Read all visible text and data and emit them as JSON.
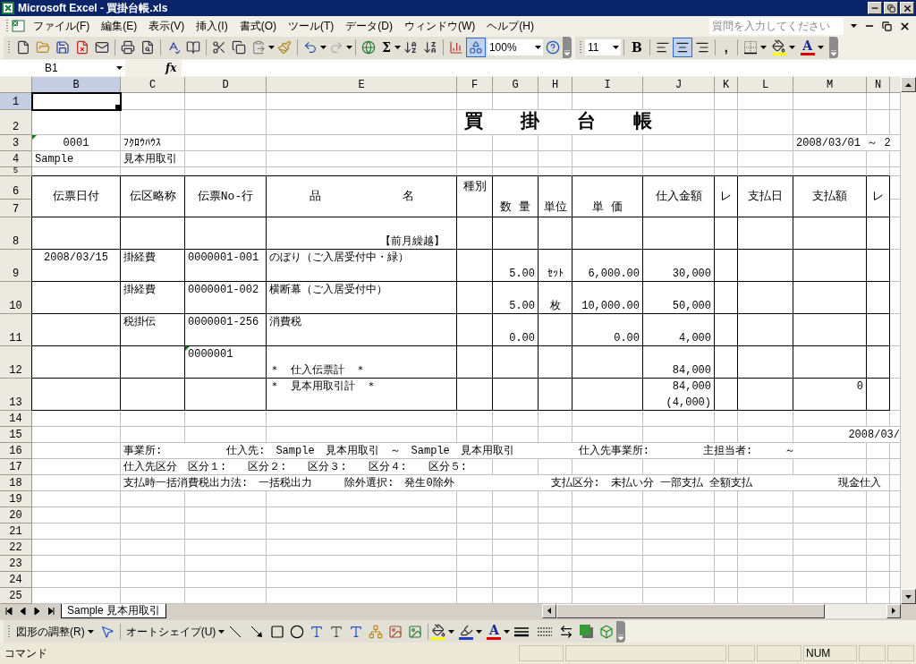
{
  "window": {
    "title": "Microsoft Excel - 買掛台帳.xls"
  },
  "menu": [
    {
      "label": "ファイル(F)"
    },
    {
      "label": "編集(E)"
    },
    {
      "label": "表示(V)"
    },
    {
      "label": "挿入(I)"
    },
    {
      "label": "書式(O)"
    },
    {
      "label": "ツール(T)"
    },
    {
      "label": "データ(D)"
    },
    {
      "label": "ウィンドウ(W)"
    },
    {
      "label": "ヘルプ(H)"
    }
  ],
  "question_box": {
    "placeholder": "質問を入力してください"
  },
  "standard_toolbar": {
    "autosum": "Σ",
    "zoom": "100%",
    "drawing_pressed": true
  },
  "formatting_toolbar": {
    "font_size": "11",
    "bold": "B",
    "comma": ",",
    "font_color": "A",
    "alignment": [
      {
        "selected": false
      },
      {
        "selected": true
      },
      {
        "selected": false
      }
    ]
  },
  "formula_bar": {
    "name_box": "B1",
    "function_label": "fx"
  },
  "columns": [
    {
      "label": "B",
      "selected": true
    },
    {
      "label": "C",
      "selected": false
    },
    {
      "label": "D",
      "selected": false
    },
    {
      "label": "E",
      "selected": false
    },
    {
      "label": "F",
      "selected": false
    },
    {
      "label": "G",
      "selected": false
    },
    {
      "label": "H",
      "selected": false
    },
    {
      "label": "I",
      "selected": false
    },
    {
      "label": "J",
      "selected": false
    },
    {
      "label": "K",
      "selected": false
    },
    {
      "label": "L",
      "selected": false
    },
    {
      "label": "M",
      "selected": false
    },
    {
      "label": "N",
      "selected": false
    }
  ],
  "rows": [
    {
      "label": "1",
      "selected": true
    },
    {
      "label": "2",
      "selected": false,
      "cells": {
        "F": {
          "text": "買　　掛　　台　　帳",
          "kind": "title",
          "flagged": false
        }
      }
    },
    {
      "label": "3",
      "selected": false,
      "cells": {
        "B": {
          "text": "0001",
          "kind": "center",
          "flagged": true
        },
        "C": {
          "text": "ﾌｸﾛｳﾊｳｽ",
          "kind": "text",
          "flagged": false
        },
        "M": {
          "text": "2008/03/01 ～ 2",
          "kind": "text",
          "flagged": false
        }
      }
    },
    {
      "label": "4",
      "selected": false,
      "cells": {
        "B": {
          "text": "Sample",
          "kind": "text",
          "flagged": false
        },
        "C": {
          "text": "見本用取引",
          "kind": "text",
          "flagged": false
        }
      }
    },
    {
      "label": "5",
      "selected": false
    },
    {
      "label": "6",
      "selected": false,
      "cells": {
        "B": {
          "text": "伝票日付",
          "kind": "head-middle",
          "flagged": false
        },
        "C": {
          "text": "伝区略称",
          "kind": "head-middle",
          "flagged": false
        },
        "D": {
          "text": "伝票No-行",
          "kind": "head-middle",
          "flagged": false
        },
        "E": {
          "text": "品　　　　　　　名",
          "kind": "head-middle",
          "flagged": false
        },
        "F": {
          "text": "種別",
          "kind": "head-top",
          "flagged": false
        },
        "G": {
          "text": "数 量",
          "kind": "head-bottom",
          "flagged": false
        },
        "H": {
          "text": "単位",
          "kind": "head-bottom",
          "flagged": false
        },
        "I": {
          "text": "単 価",
          "kind": "head-bottom",
          "flagged": false
        },
        "J": {
          "text": "仕入金額",
          "kind": "head-middle",
          "flagged": false
        },
        "K": {
          "text": "レ",
          "kind": "head-middle",
          "flagged": false
        },
        "L": {
          "text": "支払日",
          "kind": "head-middle",
          "flagged": false
        },
        "M": {
          "text": "支払額",
          "kind": "head-middle",
          "flagged": false
        },
        "N": {
          "text": "レ",
          "kind": "head-middle",
          "flagged": false
        }
      }
    },
    {
      "label": "7",
      "selected": false
    },
    {
      "label": "8",
      "selected": false,
      "cells": {
        "E": {
          "text": "【前月繰越】",
          "kind": "caption",
          "flagged": false
        }
      }
    },
    {
      "label": "9",
      "selected": false,
      "cells": {
        "B": {
          "text": "2008/03/15",
          "kind": "center",
          "flagged": false
        },
        "C": {
          "text": "掛経費",
          "kind": "text",
          "flagged": false
        },
        "D": {
          "text": "0000001-001",
          "kind": "text",
          "flagged": false
        },
        "E": {
          "text": "のぼり（ご入居受付中・緑）",
          "kind": "text",
          "flagged": false
        },
        "G": {
          "text": "5.00",
          "kind": "value",
          "flagged": false
        },
        "H": {
          "text": "ｾｯﾄ",
          "kind": "unit",
          "flagged": false
        },
        "I": {
          "text": "6,000.00",
          "kind": "value",
          "flagged": false
        },
        "J": {
          "text": "30,000",
          "kind": "value",
          "flagged": false
        }
      }
    },
    {
      "label": "10",
      "selected": false,
      "cells": {
        "C": {
          "text": "掛経費",
          "kind": "text",
          "flagged": false
        },
        "D": {
          "text": "0000001-002",
          "kind": "text",
          "flagged": false
        },
        "E": {
          "text": "横断幕（ご入居受付中）",
          "kind": "text",
          "flagged": false
        },
        "G": {
          "text": "5.00",
          "kind": "value",
          "flagged": false
        },
        "H": {
          "text": "枚",
          "kind": "unit",
          "flagged": false
        },
        "I": {
          "text": "10,000.00",
          "kind": "value",
          "flagged": false
        },
        "J": {
          "text": "50,000",
          "kind": "value",
          "flagged": false
        }
      }
    },
    {
      "label": "11",
      "selected": false,
      "cells": {
        "C": {
          "text": "税掛伝",
          "kind": "text",
          "flagged": false
        },
        "D": {
          "text": "0000001-256",
          "kind": "text",
          "flagged": false
        },
        "E": {
          "text": "消費税",
          "kind": "text",
          "flagged": false
        },
        "G": {
          "text": "0.00",
          "kind": "value",
          "flagged": false
        },
        "I": {
          "text": "0.00",
          "kind": "value",
          "flagged": false
        },
        "J": {
          "text": "4,000",
          "kind": "value",
          "flagged": false
        }
      }
    },
    {
      "label": "12",
      "selected": false,
      "cells": {
        "D": {
          "text": "0000001",
          "kind": "text",
          "flagged": true
        },
        "E": {
          "text": "＊　仕入伝票計　＊",
          "kind": "text-low",
          "flagged": false
        },
        "J": {
          "text": "84,000",
          "kind": "value",
          "flagged": false
        }
      }
    },
    {
      "label": "13",
      "selected": false,
      "cells": {
        "E": {
          "text": "＊　見本用取引計　＊",
          "kind": "text",
          "flagged": false
        },
        "J": {
          "lines": [
            "84,000",
            "(4,000)"
          ],
          "kind": "value-split",
          "flagged": false
        },
        "M": {
          "text": "0",
          "kind": "value-high",
          "flagged": false
        }
      }
    },
    {
      "label": "14",
      "selected": false
    },
    {
      "label": "15",
      "selected": false,
      "cells": {
        "M": {
          "text": "2008/03/",
          "kind": "edge",
          "flagged": false
        }
      }
    },
    {
      "label": "16",
      "selected": false,
      "cells": {
        "C": {
          "text": "事業所:　　　　　　仕入先:　Sample　見本用取引　～　Sample　見本用取引　　　　　　仕入先事業所:　　　　　主担当者:　　　～",
          "kind": "text",
          "flagged": false
        }
      }
    },
    {
      "label": "17",
      "selected": false,
      "cells": {
        "C": {
          "text": "仕入先区分　区分１:　　区分２:　　区分３:　　区分４:　　区分５:",
          "kind": "text",
          "flagged": false
        }
      }
    },
    {
      "label": "18",
      "selected": false,
      "cells": {
        "C": {
          "text": "支払時一括消費税出力法:　一括税出力　　　除外選択:　発生0除外　　　　　　　　　支払区分:　未払い分 一部支払 全額支払　　　　　　　　現金仕入",
          "kind": "text",
          "flagged": false
        }
      }
    },
    {
      "label": "19",
      "selected": false
    },
    {
      "label": "20",
      "selected": false
    },
    {
      "label": "21",
      "selected": false
    },
    {
      "label": "22",
      "selected": false
    },
    {
      "label": "23",
      "selected": false
    },
    {
      "label": "24",
      "selected": false
    },
    {
      "label": "25",
      "selected": false
    }
  ],
  "sheet_tabs": [
    {
      "label": "Sample 見本用取引",
      "selected": true
    }
  ],
  "drawing_toolbar": {
    "draw_menu": "図形の調整(R)",
    "autoshapes_menu": "オートシェイプ(U)",
    "font_color": "A"
  },
  "status_bar": {
    "mode": "コマンド",
    "num": "NUM"
  }
}
